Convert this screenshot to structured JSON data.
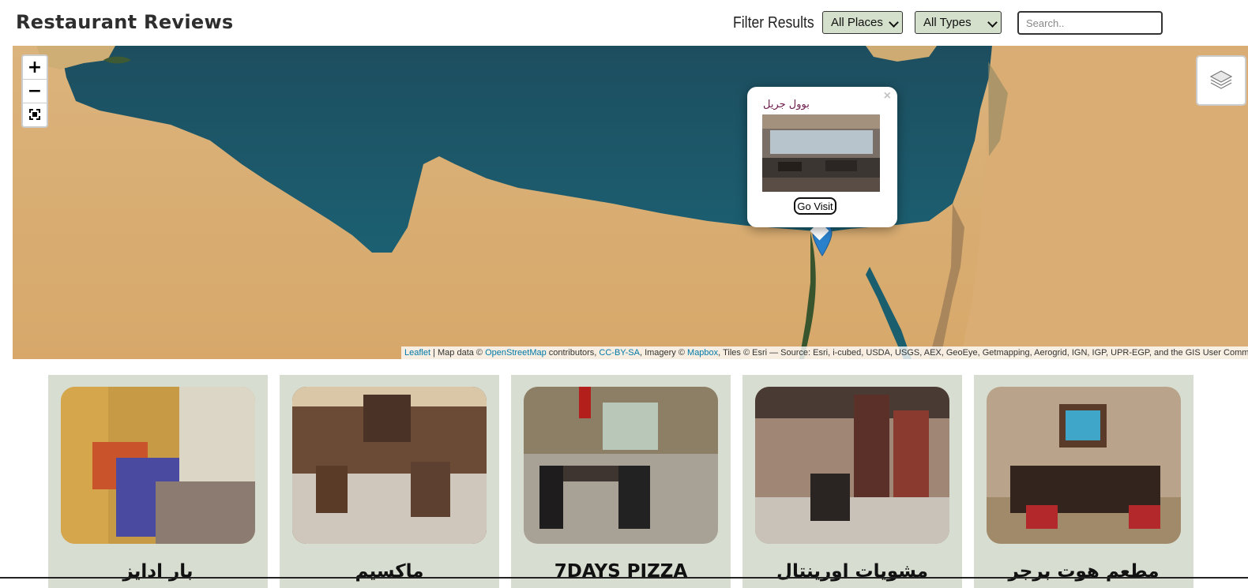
{
  "header": {
    "title": "Restaurant Reviews",
    "filter_label": "Filter Results",
    "places_select": "All Places",
    "types_select": "All Types",
    "search_placeholder": "Search.."
  },
  "map": {
    "zoom_in": "+",
    "zoom_out": "−",
    "popup": {
      "title": "بوول جريل",
      "close": "×",
      "button": "Go Visit"
    },
    "attribution": {
      "leaflet": "Leaflet",
      "sep1": " | Map data © ",
      "osm": "OpenStreetMap",
      "contrib": " contributors, ",
      "license": "CC-BY-SA",
      "imagery": ", Imagery © ",
      "mapbox": "Mapbox",
      "tiles": ", Tiles © Esri — Source: Esri, i-cubed, USDA, USGS, AEX, GeoEye, Getmapping, Aerogrid, IGN, IGP, UPR-EGP, and the GIS User Community"
    }
  },
  "restaurants": [
    {
      "name": "بار ادايز"
    },
    {
      "name": "ماكسيم"
    },
    {
      "name": "7DAYS PIZZA"
    },
    {
      "name": "مشويات اورينتال"
    },
    {
      "name": "مطعم هوت برجر"
    }
  ],
  "colors": {
    "select_bg": "#d4e0cc",
    "card_bg": "#d7ddd0",
    "link": "#0078a8",
    "marker": "#2a81cb"
  }
}
